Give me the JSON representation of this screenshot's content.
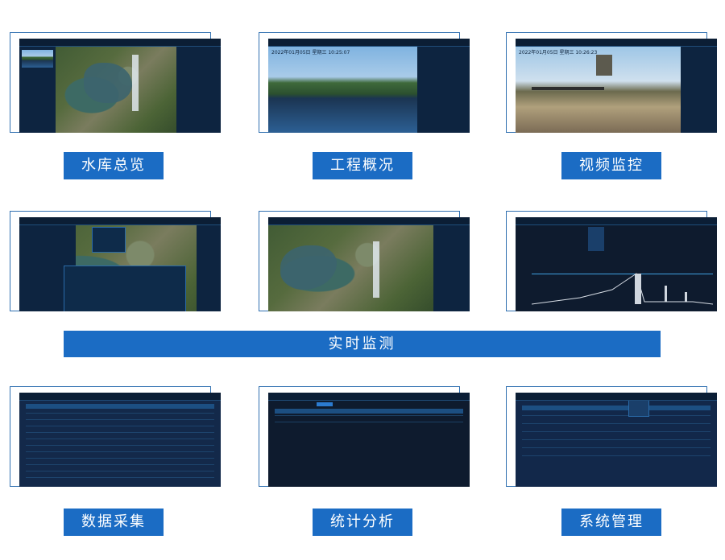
{
  "tiles": [
    {
      "label": "水库总览"
    },
    {
      "label": "工程概况"
    },
    {
      "label": "视频监控"
    },
    {
      "label": "数据采集"
    },
    {
      "label": "统计分析"
    },
    {
      "label": "系统管理"
    }
  ],
  "section_banner": "实时监测",
  "screens": {
    "overview_date": "",
    "project_date": "2022年01月05日 星期三 10:25:07",
    "video_date": "2022年01月05日 星期三 10:26:23"
  },
  "colors": {
    "accent": "#1b6cc4",
    "frame": "#2f6fb0",
    "screen_bg": "#0c1a2e"
  }
}
